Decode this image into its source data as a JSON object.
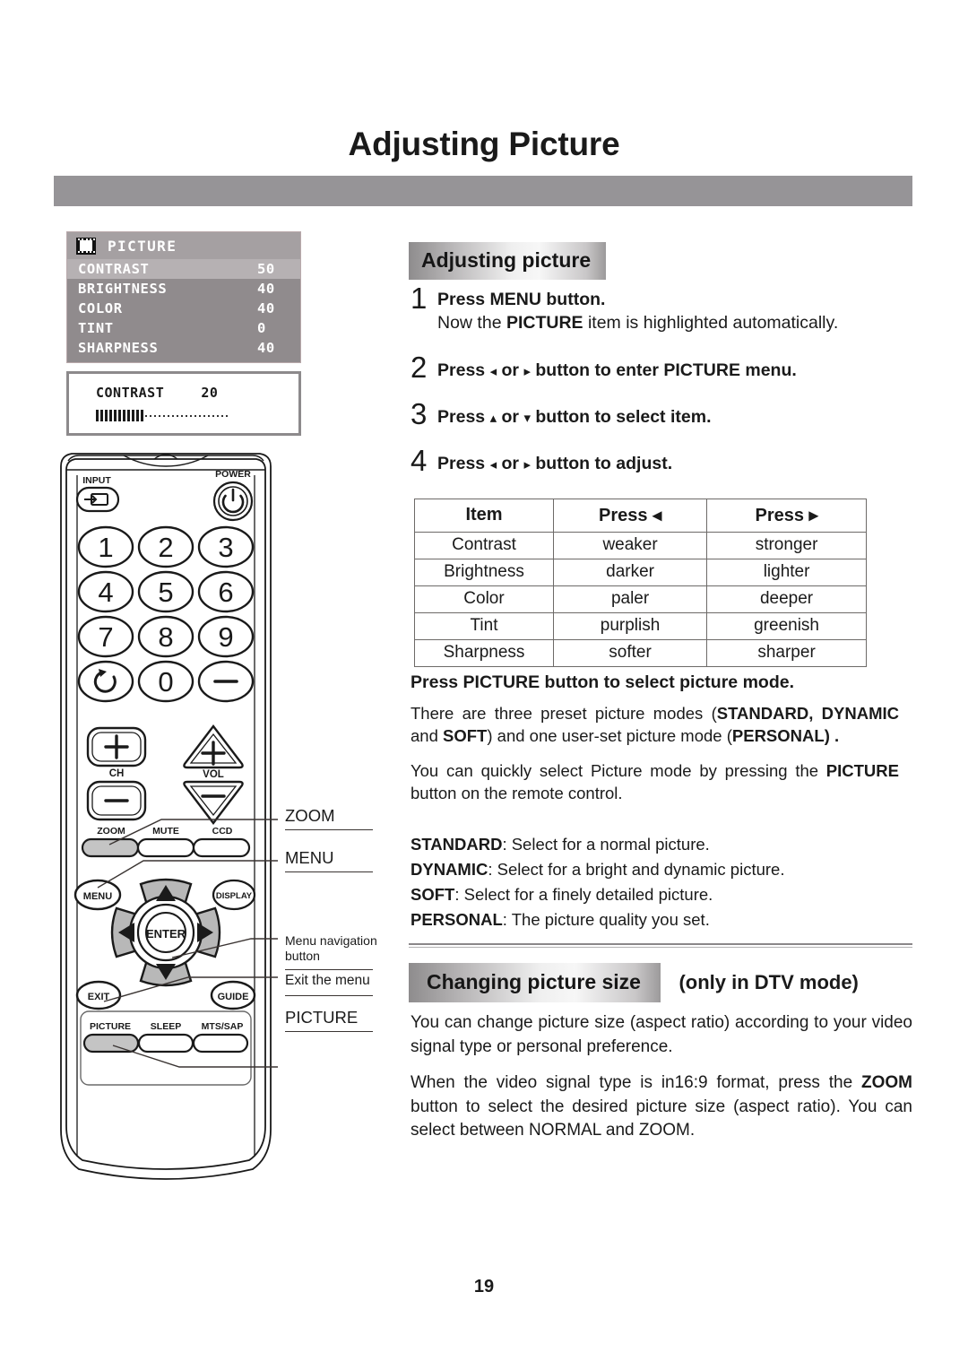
{
  "page": {
    "title": "Adjusting Picture",
    "number": "19"
  },
  "osd": {
    "icon": "film-strip-icon",
    "title": "PICTURE",
    "rows": [
      {
        "label": "CONTRAST",
        "value": "50",
        "selected": true
      },
      {
        "label": "BRIGHTNESS",
        "value": "40",
        "selected": false
      },
      {
        "label": "COLOR",
        "value": "40",
        "selected": false
      },
      {
        "label": "TINT",
        "value": "0",
        "selected": false
      },
      {
        "label": "SHARPNESS",
        "value": "40",
        "selected": false
      }
    ],
    "popup": {
      "label": "CONTRAST",
      "value": "20",
      "filled_ticks": 11,
      "empty_dots": 19
    }
  },
  "remote": {
    "labels": {
      "input": "INPUT",
      "power": "POWER",
      "ch": "CH",
      "vol": "VOL",
      "zoom": "ZOOM",
      "mute": "MUTE",
      "ccd": "CCD",
      "menu": "MENU",
      "display": "DISPLAY",
      "enter": "ENTER",
      "exit": "EXIT",
      "guide": "GUIDE",
      "picture": "PICTURE",
      "sleep": "SLEEP",
      "mtssap": "MTS/SAP"
    },
    "keys": [
      "1",
      "2",
      "3",
      "4",
      "5",
      "6",
      "7",
      "8",
      "9",
      "0"
    ],
    "key_recall": "recall-icon",
    "key_dash": "–",
    "callouts": {
      "zoom": "ZOOM",
      "menu": "MENU",
      "nav": "Menu navigation\nbutton",
      "nav_line1": "Menu navigation",
      "nav_line2": "button",
      "exit": "Exit the menu",
      "picture": "PICTURE"
    }
  },
  "sections": {
    "adjusting": {
      "badge": "Adjusting picture",
      "steps": [
        {
          "num": "1",
          "bold": "Press MENU button.",
          "normal_pre": "Now the ",
          "normal_bold": "PICTURE",
          "normal_post": " item is highlighted automatically."
        },
        {
          "num": "2",
          "line_a": "Press",
          "arrow_left": "◂",
          "line_b": "or",
          "arrow_right": "▸",
          "line_c": "button to enter PICTURE menu."
        },
        {
          "num": "3",
          "line_a": "Press",
          "arrow_left": "▴",
          "line_b": "or",
          "arrow_right": "▾",
          "line_c": "button to select item."
        },
        {
          "num": "4",
          "line_a": "Press",
          "arrow_left": "◂",
          "line_b": "or",
          "arrow_right": "▸",
          "line_c": "button to adjust."
        }
      ],
      "table": {
        "headers": [
          "Item",
          "Press ◂",
          "Press ▸"
        ],
        "rows": [
          [
            "Contrast",
            "weaker",
            "stronger"
          ],
          [
            "Brightness",
            "darker",
            "lighter"
          ],
          [
            "Color",
            "paler",
            "deeper"
          ],
          [
            "Tint",
            "purplish",
            "greenish"
          ],
          [
            "Sharpness",
            "softer",
            "sharper"
          ]
        ]
      },
      "mode_heading": "Press PICTURE button to select picture mode.",
      "mode_p1_a": "There are three preset picture modes (",
      "mode_p1_b": "STANDARD, DYNAMIC",
      "mode_p1_c": " and ",
      "mode_p1_d": "SOFT",
      "mode_p1_e": ") and one user-set picture mode (",
      "mode_p1_f": "PERSONAL",
      "mode_p1_g": ") .",
      "mode_p2_a": "You can quickly select Picture mode by pressing the ",
      "mode_p2_b": "PICTURE",
      "mode_p2_c": " button on the remote control.",
      "mode_list": [
        {
          "term": "STANDARD",
          "desc": ": Select for a normal picture."
        },
        {
          "term": "DYNAMIC",
          "desc": ": Select for a bright and dynamic picture."
        },
        {
          "term": "SOFT",
          "desc": ": Select for a finely detailed picture."
        },
        {
          "term": "PERSONAL",
          "desc": ": The picture quality you set."
        }
      ]
    },
    "changing": {
      "badge": "Changing picture size",
      "badge_suffix": "(only in DTV mode)",
      "p1": "You can change picture size (aspect ratio) according to your video signal type or personal preference.",
      "p2_a": "When the video signal type is in16:9 format, press the ",
      "p2_b": "ZOOM",
      "p2_c": " button to select the desired picture size (aspect ratio). You can select between NORMAL and ZOOM."
    }
  },
  "colors": {
    "header_bar": "#969497",
    "osd_body": "#908b8d",
    "osd_header": "#a5a0a2",
    "osd_selected": "#b6b1b3",
    "button_fill": "#c4c4c4"
  }
}
